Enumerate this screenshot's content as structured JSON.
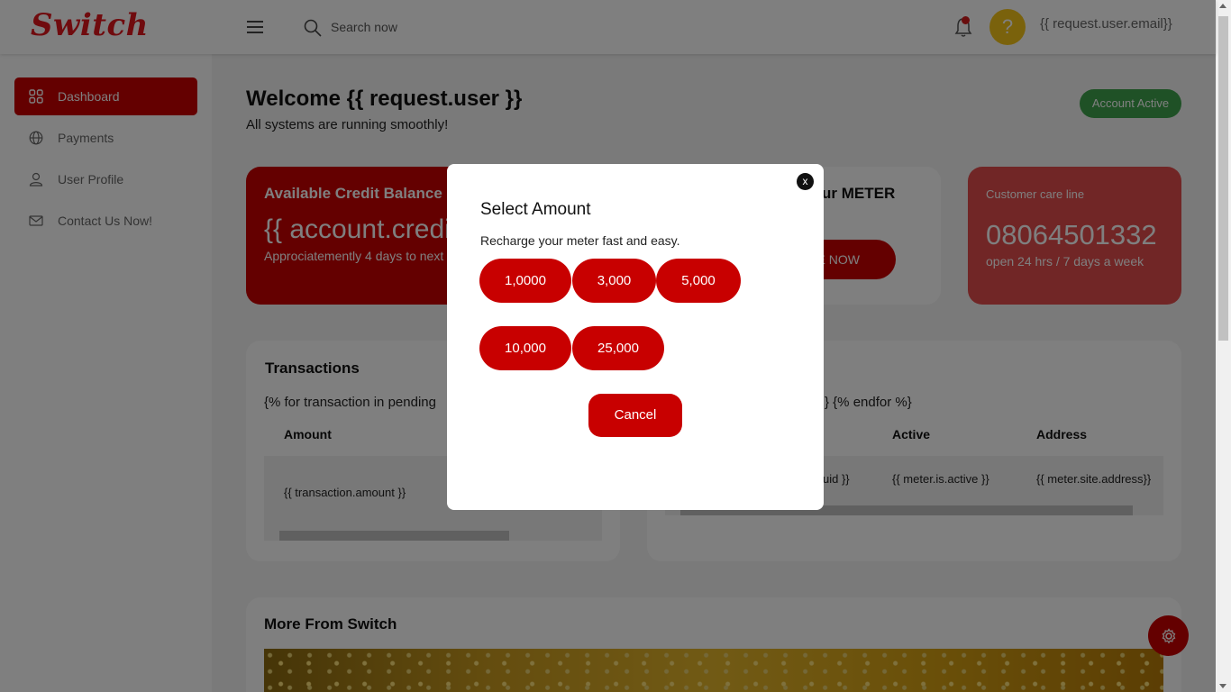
{
  "header": {
    "logo_text": "Switch",
    "search_placeholder": "Search now",
    "avatar_text": "?",
    "user_email": "{{ request.user.email}}"
  },
  "sidebar": {
    "items": [
      {
        "label": "Dashboard",
        "icon": "grid-icon",
        "active": true
      },
      {
        "label": "Payments",
        "icon": "globe-icon"
      },
      {
        "label": "User Profile",
        "icon": "user-icon"
      },
      {
        "label": "Contact Us Now!",
        "icon": "mail-icon"
      }
    ]
  },
  "main": {
    "welcome_title": "Welcome {{ request.user }}",
    "welcome_sub": "All systems are running smoothly!",
    "account_badge": "Account Active",
    "credit_card": {
      "title": "Available Credit Balance",
      "value": "{{ account.credit",
      "sub": "Approciatemently 4 days to next"
    },
    "meter_card": {
      "title": "ur METER",
      "button": "GE NOW"
    },
    "care_card": {
      "title": "Customer care line",
      "phone": "08064501332",
      "sub": "open 24 hrs / 7 days a week"
    },
    "transactions": {
      "title": "Transactions",
      "loop_text": "{% for transaction in pending",
      "header_amount": "Amount",
      "cell_amount": "{{ transaction.amount }}"
    },
    "meters": {
      "loop_end": "} {% endfor %}",
      "header_active": "Active",
      "header_address": "Address",
      "cell_uid": "uid }}",
      "cell_active": "{{ meter.is.active }}",
      "cell_address": "{{ meter.site.address}}"
    },
    "more": {
      "title": "More From Switch"
    }
  },
  "modal": {
    "close_label": "x",
    "title": "Select Amount",
    "subtitle": "Recharge your meter fast and easy.",
    "amounts": [
      "1,0000",
      "3,000",
      "5,000",
      "10,000",
      "25,000"
    ],
    "cancel_label": "Cancel"
  },
  "colors": {
    "brand_red": "#c80000",
    "badge_green": "#3fa34d",
    "care_card": "#e34d4d",
    "avatar_yellow": "#f5c518"
  }
}
